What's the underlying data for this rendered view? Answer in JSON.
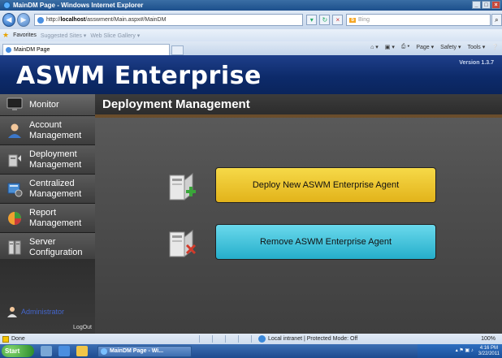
{
  "window": {
    "title": "MainDM Page - Windows Internet Explorer",
    "url_prefix": "http://",
    "url_host": "localhost",
    "url_path": "/asswment/Main.aspx#/MainDM",
    "search_engine": "Bing",
    "tab_title": "MainDM Page",
    "favorites_label": "Favorites",
    "fav_items": [
      "Suggested Sites ▾",
      "Web Slice Gallery ▾"
    ],
    "commands": [
      "Page ▾",
      "Safety ▾",
      "Tools ▾"
    ]
  },
  "app": {
    "brand": "ASWM Enterprise",
    "version": "Version 1.3.7"
  },
  "sidebar": {
    "items": [
      {
        "label": "Monitor",
        "icon": "monitor-icon"
      },
      {
        "label": "Account Management",
        "icon": "account-person-icon"
      },
      {
        "label": "Deployment Management",
        "icon": "deployment-computer-icon"
      },
      {
        "label": "Centralized Management",
        "icon": "centralized-management-icon"
      },
      {
        "label": "Report Management",
        "icon": "report-chart-icon"
      },
      {
        "label": "Server Configuration",
        "icon": "server-icon"
      }
    ],
    "user": "Administrator",
    "logout": "LogOut"
  },
  "main": {
    "title": "Deployment Management",
    "actions": [
      {
        "label": "Deploy New ASWM Enterprise Agent",
        "icon": "deploy-agent-icon",
        "color": "#e8bd22"
      },
      {
        "label": "Remove ASWM Enterprise Agent",
        "icon": "remove-agent-icon",
        "color": "#3cc1da"
      }
    ]
  },
  "statusbar": {
    "status": "Done",
    "zone": "Local intranet | Protected Mode: Off",
    "zoom": "100%"
  },
  "taskbar": {
    "start": "Start",
    "task": "MainDM Page - Wi...",
    "time": "4:16 PM",
    "date": "3/22/2011"
  },
  "colors": {
    "header_blue": "#0d2b6b",
    "deploy_yellow": "#e8bd22",
    "remove_cyan": "#3cc1da",
    "admin_blue": "#4466cc"
  }
}
